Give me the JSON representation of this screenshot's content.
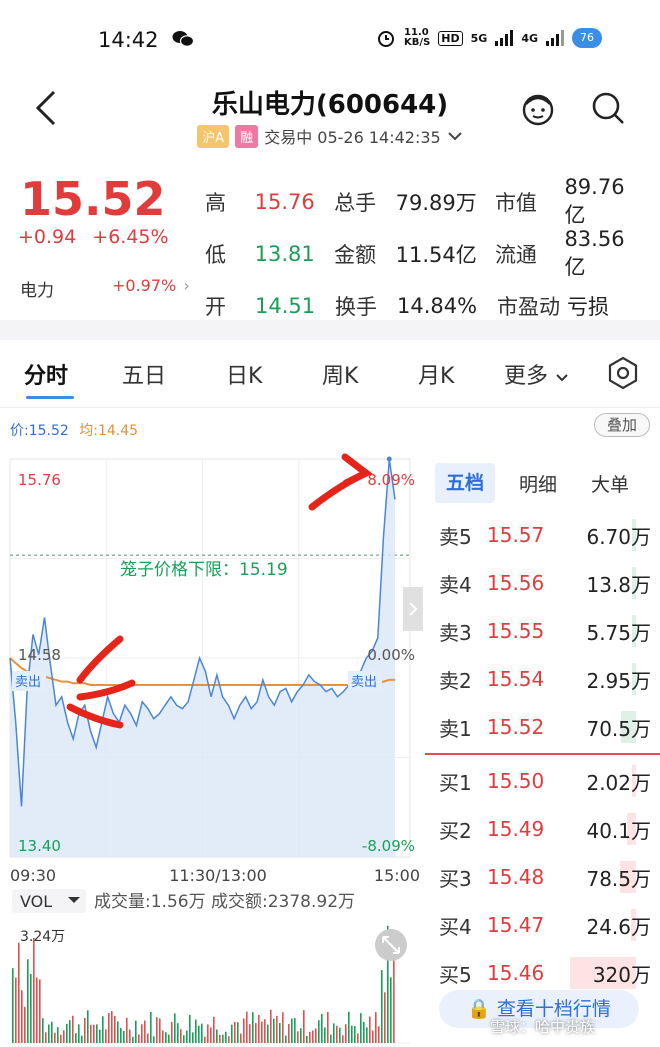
{
  "status_bar": {
    "time": "14:42",
    "net_speed": "11.0\nKB/S",
    "hd": "HD",
    "sig1": "5G",
    "sig2": "4G",
    "battery": "76"
  },
  "header": {
    "title": "乐山电力(600644)",
    "tag_market": "沪A",
    "tag_margin": "融",
    "status": "交易中 05-26 14:42:35"
  },
  "quote": {
    "price": "15.52",
    "change": "+0.94",
    "change_pct": "+6.45%",
    "sector": "电力",
    "sector_change": "+0.97%",
    "rows": [
      {
        "l1": "高",
        "v1": "15.76",
        "c1": "#e03c3c",
        "l2": "总手",
        "v2": "79.89万",
        "l3": "市值",
        "v3": "89.76亿"
      },
      {
        "l1": "低",
        "v1": "13.81",
        "c1": "#18a058",
        "l2": "金额",
        "v2": "11.54亿",
        "l3": "流通",
        "v3": "83.56亿"
      },
      {
        "l1": "开",
        "v1": "14.51",
        "c1": "#18a058",
        "l2": "换手",
        "v2": "14.84%",
        "l3": "市盈动",
        "v3": "亏损"
      }
    ]
  },
  "tabs": [
    "分时",
    "五日",
    "日K",
    "周K",
    "月K",
    "更多"
  ],
  "chart_legend": {
    "price": "价:15.52",
    "avg": "均:14.45",
    "overlay": "叠加"
  },
  "chart_data": {
    "type": "line",
    "title": "",
    "x_ticks": [
      "09:30",
      "11:30/13:00",
      "15:00"
    ],
    "y_ticks_left": [
      "15.76",
      "14.58",
      "13.40"
    ],
    "y_ticks_right": [
      "8.09%",
      "0.00%",
      "-8.09%"
    ],
    "ylim": [
      13.4,
      15.76
    ],
    "annotation": "笼子价格下限：15.19",
    "cage_lower_limit": 15.19,
    "sell_marks": [
      "卖出",
      "卖出"
    ],
    "series": [
      {
        "name": "价",
        "color": "#4a86d8",
        "values": [
          14.58,
          14.2,
          13.7,
          14.4,
          14.72,
          14.6,
          14.82,
          14.55,
          14.3,
          14.35,
          14.2,
          14.1,
          14.25,
          14.3,
          14.15,
          14.05,
          14.2,
          14.35,
          14.25,
          14.2,
          14.3,
          14.25,
          14.18,
          14.32,
          14.28,
          14.22,
          14.25,
          14.3,
          14.35,
          14.3,
          14.28,
          14.32,
          14.45,
          14.58,
          14.5,
          14.35,
          14.48,
          14.35,
          14.3,
          14.22,
          14.3,
          14.35,
          14.28,
          14.32,
          14.45,
          14.35,
          14.3,
          14.38,
          14.4,
          14.32,
          14.38,
          14.42,
          14.48,
          14.44,
          14.42,
          14.38,
          14.4,
          14.35,
          14.38,
          14.42,
          14.45,
          14.5,
          14.58,
          14.62,
          14.7,
          15.3,
          15.76,
          15.52
        ]
      },
      {
        "name": "均",
        "color": "#e8903a",
        "values": [
          14.58,
          14.55,
          14.52,
          14.5,
          14.49,
          14.48,
          14.47,
          14.46,
          14.45,
          14.44,
          14.44,
          14.43,
          14.43,
          14.43,
          14.42,
          14.42,
          14.42,
          14.42,
          14.42,
          14.42,
          14.42,
          14.42,
          14.42,
          14.42,
          14.42,
          14.42,
          14.42,
          14.42,
          14.42,
          14.42,
          14.42,
          14.42,
          14.42,
          14.42,
          14.42,
          14.42,
          14.42,
          14.42,
          14.42,
          14.42,
          14.42,
          14.42,
          14.42,
          14.42,
          14.42,
          14.42,
          14.42,
          14.42,
          14.42,
          14.42,
          14.42,
          14.42,
          14.42,
          14.42,
          14.42,
          14.42,
          14.42,
          14.42,
          14.42,
          14.42,
          14.42,
          14.42,
          14.42,
          14.42,
          14.43,
          14.44,
          14.45,
          14.45
        ]
      }
    ]
  },
  "volume": {
    "label": "VOL",
    "summary": "成交量:1.56万 成交额:2378.92万",
    "max_label": "3.24万"
  },
  "orderbook": {
    "tabs": [
      "五档",
      "明细",
      "大单"
    ],
    "asks": [
      {
        "label": "卖5",
        "price": "15.57",
        "vol": "6.70万",
        "bar": 0.02
      },
      {
        "label": "卖4",
        "price": "15.56",
        "vol": "13.8万",
        "bar": 0.04
      },
      {
        "label": "卖3",
        "price": "15.55",
        "vol": "5.75万",
        "bar": 0.02
      },
      {
        "label": "卖2",
        "price": "15.54",
        "vol": "2.95万",
        "bar": 0.01
      },
      {
        "label": "卖1",
        "price": "15.52",
        "vol": "70.5万",
        "bar": 0.22
      }
    ],
    "bids": [
      {
        "label": "买1",
        "price": "15.50",
        "vol": "2.02万",
        "bar": 0.01
      },
      {
        "label": "买2",
        "price": "15.49",
        "vol": "40.1万",
        "bar": 0.13
      },
      {
        "label": "买3",
        "price": "15.48",
        "vol": "78.5万",
        "bar": 0.25
      },
      {
        "label": "买4",
        "price": "15.47",
        "vol": "24.6万",
        "bar": 0.08
      },
      {
        "label": "买5",
        "price": "15.46",
        "vol": "320万",
        "bar": 1.0
      }
    ],
    "ten_levels": "查看十档行情"
  },
  "watermark": "雪球：哈中贵族"
}
